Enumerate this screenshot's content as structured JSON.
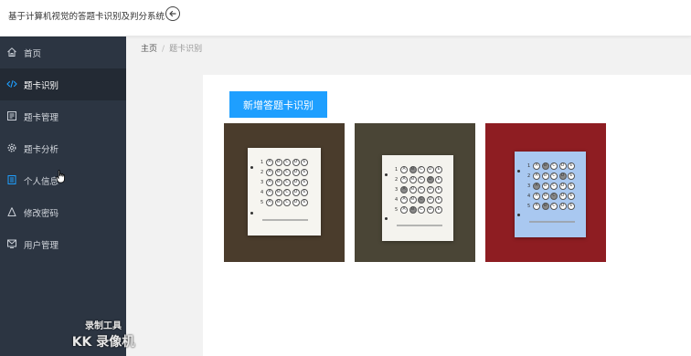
{
  "header": {
    "title": "基于计算机视觉的答题卡识别及判分系统"
  },
  "sidebar": {
    "items": [
      {
        "label": "首页",
        "icon": "home-icon"
      },
      {
        "label": "题卡识别",
        "icon": "code-icon",
        "active": true
      },
      {
        "label": "题卡管理",
        "icon": "list-icon"
      },
      {
        "label": "题卡分析",
        "icon": "gear-icon"
      },
      {
        "label": "个人信息",
        "icon": "id-card-icon"
      },
      {
        "label": "修改密码",
        "icon": "lock-icon"
      },
      {
        "label": "用户管理",
        "icon": "user-icon"
      }
    ]
  },
  "breadcrumb": {
    "home": "主页",
    "sep": "/",
    "current": "题卡识别"
  },
  "main": {
    "add_button": "新增答题卡识别"
  },
  "sheet": {
    "rows": [
      "1",
      "2",
      "3",
      "4",
      "5"
    ],
    "choices": [
      "A",
      "B",
      "C",
      "D",
      "E"
    ]
  },
  "colors": {
    "sidebar_bg": "#2c3542",
    "accent": "#1e9fff",
    "thumb1_bg": "#4a3c2c",
    "thumb2_bg": "#4a4536",
    "thumb3_bg": "#8e1d22",
    "sheet3_tint": "#a9c8f0"
  },
  "watermark": {
    "line1": "录制工具",
    "line2": "KK 录像机"
  }
}
